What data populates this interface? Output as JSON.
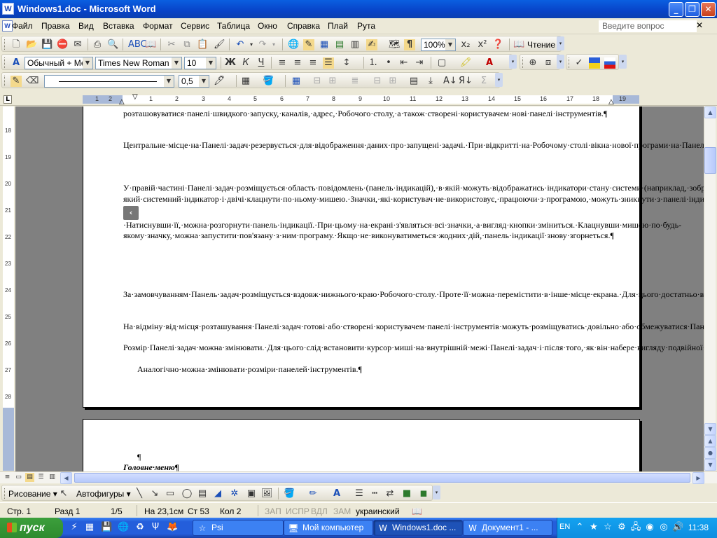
{
  "window": {
    "title": "Windows1.doc - Microsoft Word",
    "app_icon": "word-icon"
  },
  "menu": {
    "items": [
      "Файл",
      "Правка",
      "Вид",
      "Вставка",
      "Формат",
      "Сервис",
      "Таблица",
      "Окно",
      "Справка",
      "Плай",
      "Рута"
    ],
    "help_placeholder": "Введите вопрос"
  },
  "toolbar_standard": {
    "zoom": "100%",
    "reading": "Чтение"
  },
  "toolbar_format": {
    "style": "Обычный + Мех",
    "font": "Times New Roman",
    "size": "10"
  },
  "toolbar_tables": {
    "line_weight": "0,5"
  },
  "ruler": {
    "marks": [
      "1",
      "2",
      "1",
      "2",
      "3",
      "4",
      "5",
      "6",
      "7",
      "8",
      "9",
      "10",
      "11",
      "12",
      "13",
      "14",
      "15",
      "16",
      "17",
      "18",
      "19"
    ]
  },
  "vruler": {
    "marks": [
      "18",
      "19",
      "20",
      "21",
      "22",
      "23",
      "24",
      "25",
      "26",
      "27",
      "28"
    ]
  },
  "document": {
    "p0": "розташовуватися·панелі·швидкого·запуску,·каналів,·адрес,·Робочого·столу,·а·також·створені·користувачем·нові·панелі·інструментів.¶",
    "p1": "Центральне·місце·на·Панелі·задач·резервується·для·відображення·даних·про·запущені·задачі.·При·відкритті·на·Робочому·столі·вікна·нової·програми·на·Панелі·задач·автоматично·з'являється·відповідна·цій·програмі·кнопка·із·зображенням·піктограми·задачі·й·назвою·програми.·Для·активізації·задачі·достатньо·клацнути·по·цій·кнопці·мишею.·Після·закриття·вікна·відповідна·йому·кнопка·зникає·з·Панелі·задач.¶",
    "p2a": "У·правій·частині·Панелі·задач·розміщується·область·повідомлень·(панель·індикацій),·в·якій·можуть·відображатись·індикатори·стану·системи·(наприклад,·зображення·принтера·під·час·роботи,·регулятор·рівня·гучності·звуку).·Мовна·панель·автоматично·відображається·на·Панелі·задач,·якщо·використовується·кілька·мов·або·розкладок·клавіатури.·У·правому·куті·Панелі·задач·розташований·значок·годинника.·Для·перегляду·та·зміни·параметрів·треба·встановити·курсор·миші·на·будь-який·системний·індикатор·і·двічі·клацнути·по·ньому·мишею.·Значки,·які·користувач·не·використовує,·працюючи·з·програмою,·можуть·зникнути·з·панелі·індикації.·У·цьому·разі·на·краю·панелі·з'являється·спеціальна·кнопка·",
    "p2b": "·Натиснувши·її,·можна·розгорнути·панель·індикації.·При·цьому·на·екрані·з'являться·всі·значки,·а·вигляд·кнопки·зміниться.·Клацнувши·мишею·по·будь-якому·значку,·можна·запустити·пов'язану·з·ним·програму.·Якщо·не·виконуватиметься·жодних·дій,·панель·індикації·знову·згорнеться.¶",
    "p3": "За·замовчуванням·Панель·задач·розміщується·вздовж·нижнього·краю·Робочого·столу.·Проте·її·можна·перемістити·в·інше·місце·екрана.·Для·цього·достатньо·встановити·курсор·миші·на·вільне·від·кнопок·місце·Панелі·задач,·натиснути·ліву·кнопку·миші·й·перетягнути·її·до·однієї·з·вільних·меж·екрана.¶",
    "p4": "На·відміну·від·місця·розташування·Панелі·задач·готові·або·створені·користувачем·панелі·інструментів·можуть·розміщуватись·довільно·або·обмежуватися·Панеллю·задач.¶",
    "p5": "Розмір·Панелі·задач·можна·змінювати.·Для·цього·слід·встановити·курсор·миші·на·внутрішній·межі·Панелі·задач·і·після·того,·як·він·набере·вигляду·подвійної·стрілки,·перемістити·цю·межу·в·нове·місце·при·натиснутій·лівій·кнопці·миші.·Зауважимо,·що·розмір·Панелі·задач·не·може·перевищувати·половини·Робочого·столу.¶",
    "p6": "Аналогічно·можна·змінювати·розміри·панелей·інструментів.¶",
    "page2_mark": "¶",
    "page2_heading": "Головне·меню¶"
  },
  "drawing_toolbar": {
    "draw": "Рисование ▾",
    "autoshapes": "Автофигуры ▾"
  },
  "status": {
    "page": "Стр. 1",
    "section": "Разд 1",
    "pages": "1/5",
    "at": "На 23,1см",
    "line": "Ст 53",
    "col": "Кол 2",
    "rec": "ЗАП",
    "trk": "ИСПР",
    "ext": "ВДЛ",
    "ovr": "ЗАМ",
    "language": "украинский"
  },
  "taskbar": {
    "start": "пуск",
    "items": [
      "Psi",
      "Мой компьютер",
      "Windows1.doc ...",
      "Документ1 - ..."
    ],
    "language": "EN",
    "clock": "11:38"
  }
}
